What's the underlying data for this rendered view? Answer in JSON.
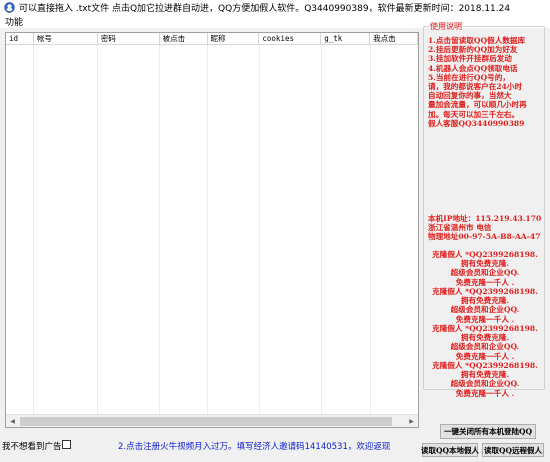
{
  "window": {
    "title": "可以直接拖入 .txt文件 点击Q加它拉进群自动进，QQ方便加假人软件。Q3440990389，软件最新更新时间：2018.11.24"
  },
  "menu": {
    "items": [
      "功能"
    ]
  },
  "table": {
    "columns": [
      "id",
      "帐号",
      "密码",
      "被点击",
      "昵称",
      "cookies",
      "g_tk",
      "我点击"
    ]
  },
  "notice": {
    "legend": "使用说明",
    "instructions": "1.点击留读取QQ假人数据库\n2.挂后更新的QQ加为好友\n3.挂加软件开挂群后发动\n4.机器人会点QQ领取电话\n5.当前在进行QQ号的，\n请，我的都说客户在24小时\n自动回复你的事，当然大\n量加会流量，可以顺几小时再\n加。每天可以加三千左右。\n假人客服QQ3440990389",
    "ip_info": "本机IP地址：115.219.43.170\n浙江省温州市 电信\n物理地址00-97-5A-B8-AA-47",
    "ads": [
      "克隆假人 *QQ2399268198.\n拥有免费克隆.\n超级会员和企业QQ.\n免费克隆一千人 .",
      "克隆假人 *QQ2399268198.\n拥有免费克隆.\n超级会员和企业QQ.\n免费克隆一千人 .",
      "克隆假人 *QQ2399268198.\n拥有免费克隆.\n超级会员和企业QQ.\n免费克隆一千人 .",
      "克隆假人 *QQ2399268198.\n拥有免费克隆.\n超级会员和企业QQ.\n免费克隆一千人 ."
    ]
  },
  "bottom": {
    "no_ad_label": "我不想看到广告",
    "no_ad_checked": false,
    "promo": "2.点击注册火牛视频月入过万。填写经济人邀请码14140531，欢迎返现"
  },
  "buttons": {
    "close_qq": "一键关闭所有本机登陆QQ",
    "local_fake": "读取QQ本地假人",
    "remote_fake": "读取QQ远程假人"
  },
  "colors": {
    "notice_red": "#e0201e",
    "promo_blue": "#1020d0",
    "window_bg": "#f0f0f0"
  }
}
